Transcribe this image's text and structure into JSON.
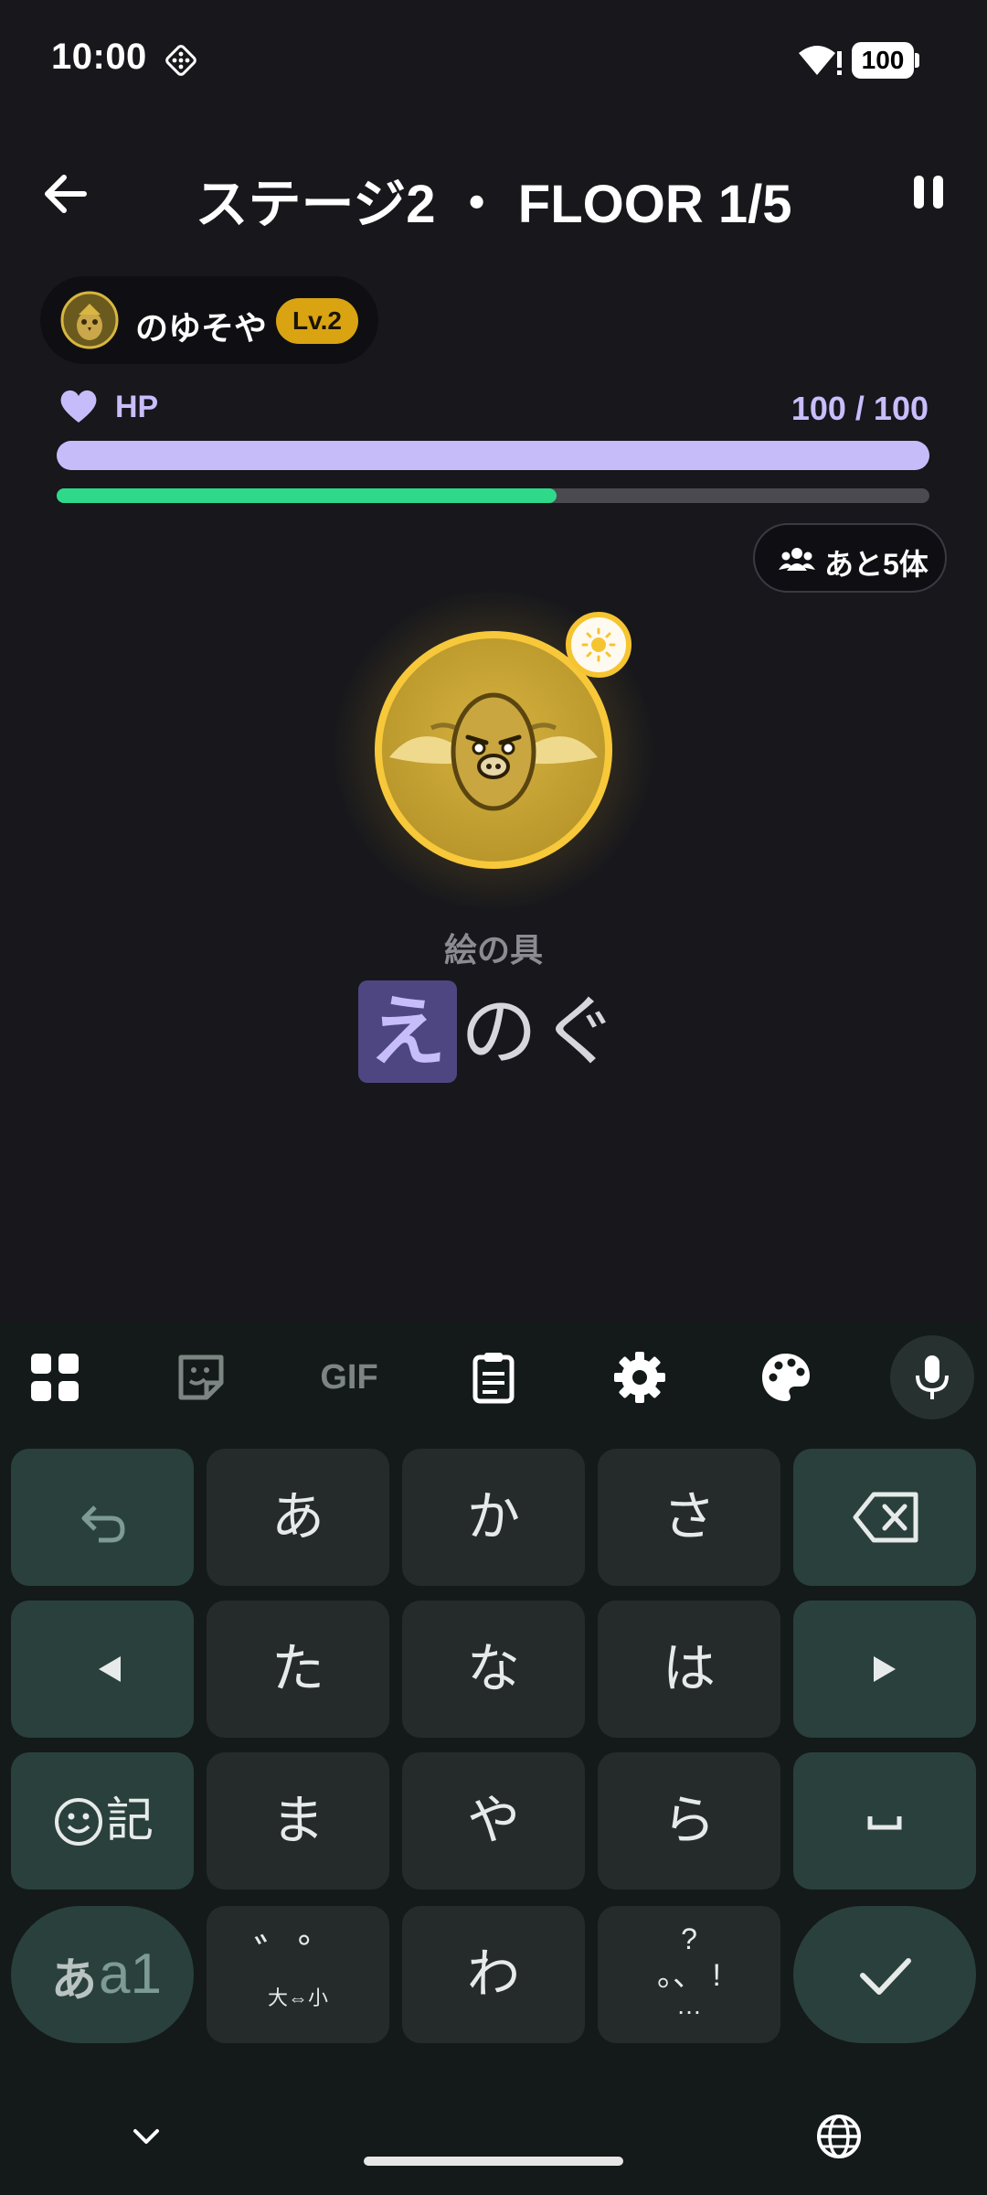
{
  "status_bar": {
    "time": "10:00",
    "battery": "100",
    "icons": [
      "notification-dice-icon",
      "wifi-alert-icon",
      "battery-icon"
    ]
  },
  "header": {
    "title": "ステージ2 ・ FLOOR 1/5",
    "back_icon": "arrow-left-icon",
    "pause_icon": "pause-icon"
  },
  "player": {
    "name": "のゆそや",
    "level": "Lv.2",
    "avatar_icon": "owl-avatar-icon"
  },
  "hp": {
    "label": "HP",
    "value_text": "100 / 100",
    "fill_fraction": 1.0,
    "color": "#c7bcfa"
  },
  "progress": {
    "fill_fraction": 0.573,
    "color": "#2fd98a"
  },
  "enemies": {
    "remaining_text": "あと5体",
    "icon": "group-icon"
  },
  "enemy": {
    "avatar_icon": "winged-egg-enemy-icon",
    "element_icon": "sun-icon",
    "accent": "#f5c431"
  },
  "word": {
    "meaning": "絵の具",
    "typed": "え",
    "remaining": "のぐ"
  },
  "keyboard": {
    "toolbar_icons": [
      "apps-grid-icon",
      "sticker-icon",
      "gif-icon",
      "clipboard-icon",
      "settings-icon",
      "palette-icon",
      "microphone-icon"
    ],
    "gif_label": "GIF",
    "rows": [
      [
        "undo",
        "あ",
        "か",
        "さ",
        "backspace"
      ],
      [
        "left",
        "た",
        "な",
        "は",
        "right"
      ],
      [
        "emoji",
        "ま",
        "や",
        "ら",
        "space"
      ],
      [
        "mode",
        "dakuten",
        "わ",
        "punct",
        "enter"
      ]
    ],
    "key_a": "あ",
    "key_ka": "か",
    "key_sa": "さ",
    "key_ta": "た",
    "key_na": "な",
    "key_ha": "は",
    "key_ma": "ま",
    "key_ya": "や",
    "key_ra": "ら",
    "key_wa": "わ",
    "emoji_key_label": "記",
    "mode_key_kana": "あ",
    "mode_key_latin": "a1",
    "dakuten_top": "゛゜",
    "dakuten_bottom": "大⇔小",
    "punct_top": "?",
    "punct_mid": "。、 !",
    "punct_bottom": "…"
  }
}
